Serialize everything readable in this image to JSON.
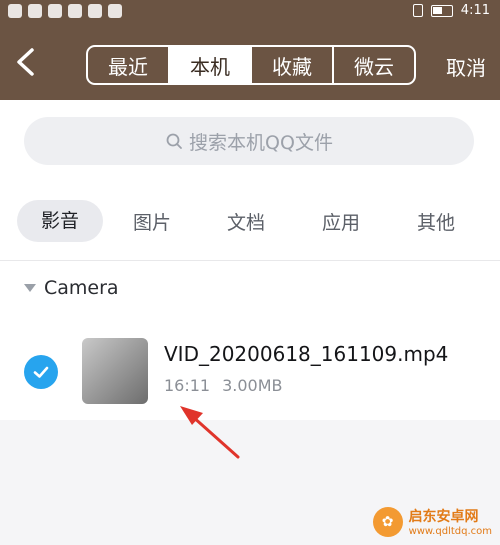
{
  "statusbar": {
    "time": "4:11"
  },
  "header": {
    "tabs": [
      "最近",
      "本机",
      "收藏",
      "微云"
    ],
    "active_tab_index": 1,
    "cancel_label": "取消"
  },
  "search": {
    "placeholder": "搜索本机QQ文件"
  },
  "categories": [
    "影音",
    "图片",
    "文档",
    "应用",
    "其他"
  ],
  "folder": {
    "name": "Camera"
  },
  "file": {
    "name": "VID_20200618_161109.mp4",
    "time": "16:11",
    "size": "3.00MB",
    "selected": true
  },
  "watermark": {
    "title": "启东安卓网",
    "url": "www.qdltdq.com"
  },
  "colors": {
    "header_bg": "#6b5443",
    "check_blue": "#27a4ee",
    "arrow_red": "#e0342b"
  }
}
